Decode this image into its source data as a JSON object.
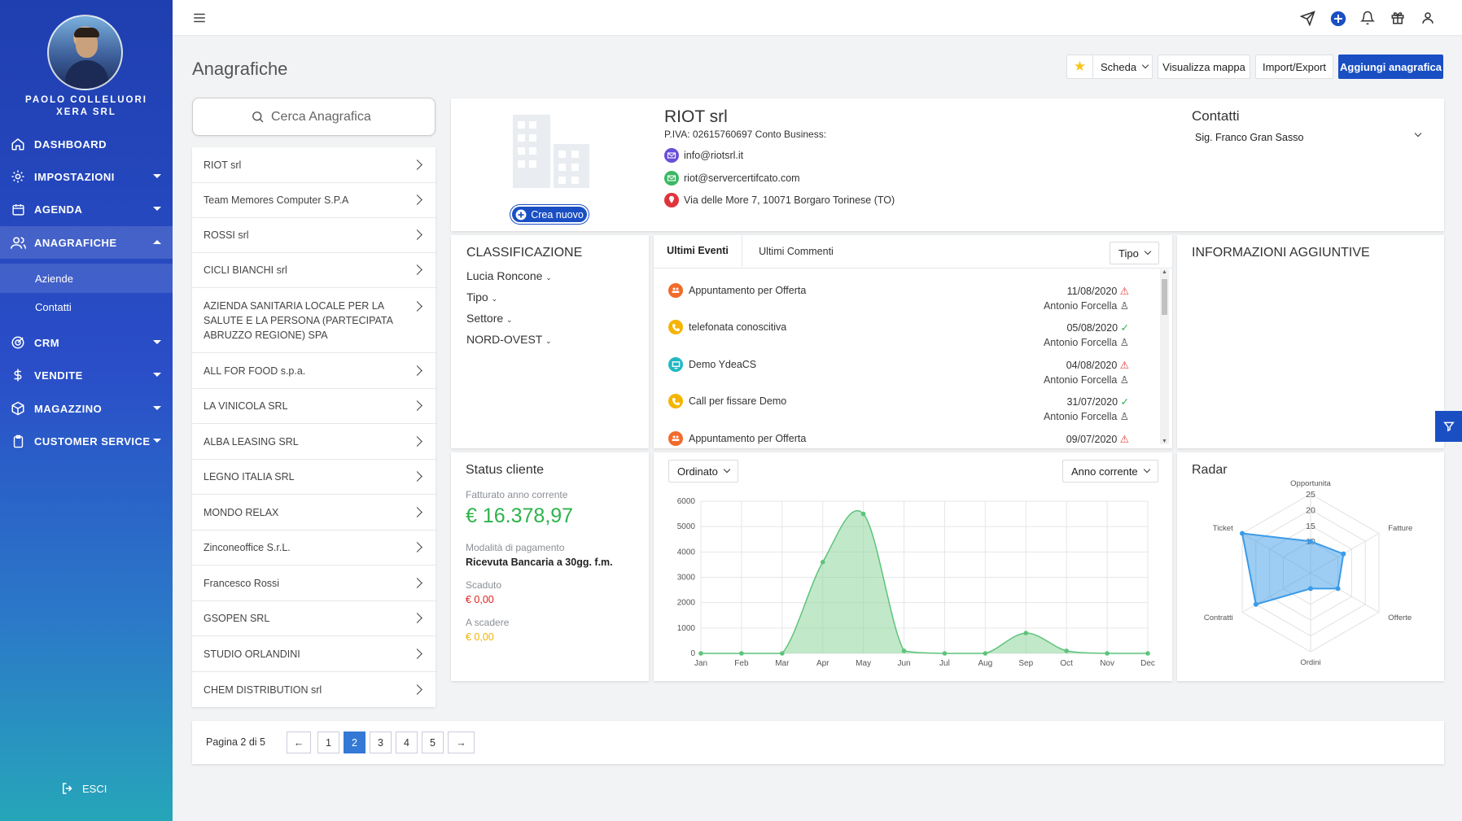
{
  "user": {
    "name": "PAOLO COLLELUORI",
    "company": "XERA SRL"
  },
  "sidebar": {
    "items": [
      {
        "label": "DASHBOARD",
        "icon": "home-icon"
      },
      {
        "label": "IMPOSTAZIONI",
        "icon": "gear-icon"
      },
      {
        "label": "AGENDA",
        "icon": "calendar-icon"
      },
      {
        "label": "ANAGRAFICHE",
        "icon": "users-icon"
      },
      {
        "label": "CRM",
        "icon": "target-icon"
      },
      {
        "label": "VENDITE",
        "icon": "dollar-icon"
      },
      {
        "label": "MAGAZZINO",
        "icon": "box-icon"
      },
      {
        "label": "CUSTOMER SERVICE",
        "icon": "clipboard-icon"
      }
    ],
    "subitems": [
      {
        "label": "Aziende"
      },
      {
        "label": "Contatti"
      }
    ],
    "logout": "ESCI"
  },
  "header": {
    "title": "Anagrafiche",
    "scheda": "Scheda",
    "mappa": "Visualizza mappa",
    "import": "Import/Export",
    "add": "Aggiungi anagrafica"
  },
  "search": {
    "placeholder": "Cerca Anagrafica"
  },
  "companies": [
    "RIOT srl",
    "Team Memores Computer S.P.A",
    "ROSSI srl",
    "CICLI BIANCHI srl",
    "AZIENDA SANITARIA LOCALE PER LA SALUTE E LA PERSONA (PARTECIPATA ABRUZZO REGIONE) SPA",
    "ALL FOR FOOD s.p.a.",
    "LA VINICOLA SRL",
    "ALBA LEASING SRL",
    "LEGNO ITALIA SRL",
    "MONDO RELAX",
    "Zinconeoffice S.r.L.",
    "Francesco Rossi",
    "GSOPEN SRL",
    "STUDIO ORLANDINI",
    "CHEM DISTRIBUTION srl"
  ],
  "detail": {
    "name": "RIOT srl",
    "piva": "P.IVA: 02615760697 Conto Business:",
    "email1": "info@riotsrl.it",
    "email2": "riot@servercertifcato.com",
    "address": "Via delle More 7, 10071 Borgaro Torinese (TO)",
    "create": "Crea nuovo",
    "contacts_title": "Contatti",
    "contact_selected": "Sig. Franco Gran Sasso"
  },
  "classification": {
    "title": "CLASSIFICAZIONE",
    "items": [
      "Lucia Roncone",
      "Tipo",
      "Settore",
      "NORD-OVEST"
    ]
  },
  "events": {
    "tabs": [
      "Ultimi Eventi",
      "Ultimi Commenti"
    ],
    "filter": "Tipo",
    "list": [
      {
        "label": "Appuntamento per Offerta",
        "date": "11/08/2020",
        "who": "Antonio Forcella",
        "color": "#f26b2a",
        "status": "warning"
      },
      {
        "label": "telefonata conoscitiva",
        "date": "05/08/2020",
        "who": "Antonio Forcella",
        "color": "#f5b400",
        "status": "done"
      },
      {
        "label": "Demo YdeaCS",
        "date": "04/08/2020",
        "who": "Antonio Forcella",
        "color": "#21b8c4",
        "status": "warning"
      },
      {
        "label": "Call per fissare Demo",
        "date": "31/07/2020",
        "who": "Antonio Forcella",
        "color": "#f5b400",
        "status": "done"
      },
      {
        "label": "Appuntamento per Offerta",
        "date": "09/07/2020",
        "who": "",
        "color": "#f26b2a",
        "status": "warning"
      }
    ]
  },
  "info": {
    "title": "INFORMAZIONI AGGIUNTIVE"
  },
  "status": {
    "title": "Status cliente",
    "fatturato_label": "Fatturato anno corrente",
    "fatturato": "€ 16.378,97",
    "pagamento_label": "Modalità di pagamento",
    "pagamento": "Ricevuta Bancaria a 30gg. f.m.",
    "scaduto_label": "Scaduto",
    "scaduto": "€ 0,00",
    "ascadere_label": "A scadere",
    "ascadere": "€ 0,00"
  },
  "chart_filters": {
    "ordinato": "Ordinato",
    "periodo": "Anno corrente"
  },
  "chart_data": [
    {
      "type": "area",
      "categories": [
        "Jan",
        "Feb",
        "Mar",
        "Apr",
        "May",
        "Jun",
        "Jul",
        "Aug",
        "Sep",
        "Oct",
        "Nov",
        "Dec"
      ],
      "values": [
        0,
        0,
        0,
        3600,
        5500,
        100,
        0,
        0,
        800,
        100,
        0,
        0
      ],
      "ylim": [
        0,
        6000
      ],
      "yticks": [
        0,
        1000,
        2000,
        3000,
        4000,
        5000,
        6000
      ],
      "color": "#8fd69f"
    },
    {
      "type": "radar",
      "title": "Radar",
      "axes": [
        "Opportunita",
        "Fatture",
        "Offerte",
        "Ordini",
        "Contratti",
        "Ticket"
      ],
      "values": [
        10,
        12,
        10,
        5,
        20,
        25
      ],
      "ticks": [
        10,
        15,
        20,
        25
      ],
      "rmax": 25,
      "color": "#3b9be8"
    }
  ],
  "pagination": {
    "label": "Pagina 2 di 5",
    "prev": "←",
    "next": "→",
    "pages": [
      "1",
      "2",
      "3",
      "4",
      "5"
    ],
    "current": "2"
  },
  "colors": {
    "accent": "#1a4fc4",
    "green": "#2db34a",
    "red": "#e02020",
    "yellow": "#f0b400"
  }
}
